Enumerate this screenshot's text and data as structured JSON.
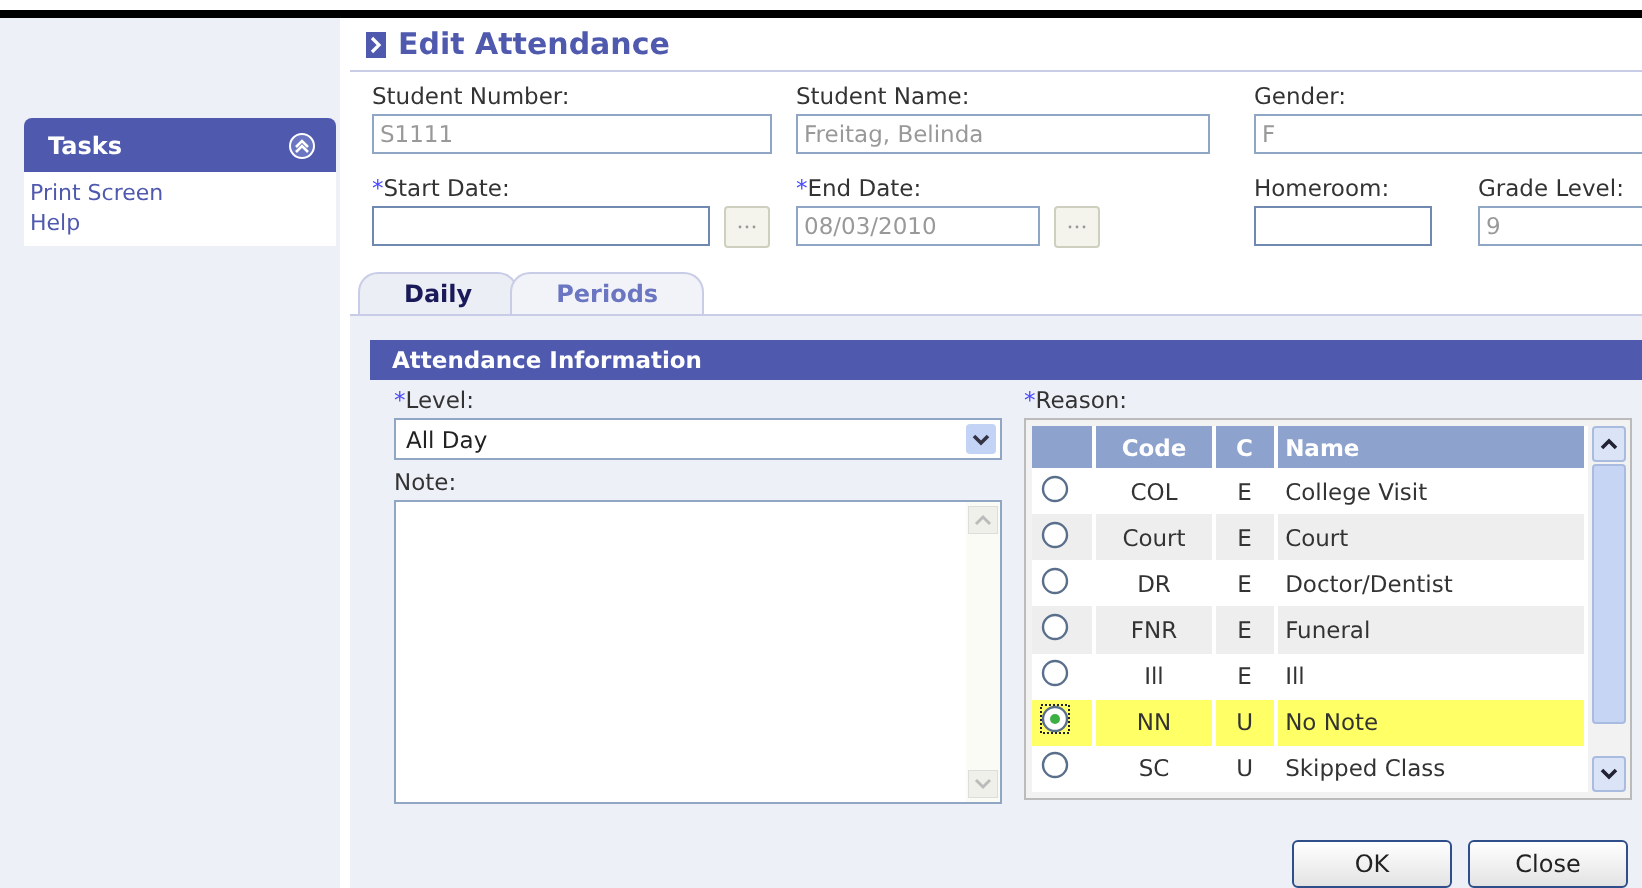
{
  "sidebar": {
    "title": "Tasks",
    "expanded": true,
    "links": [
      "Print Screen",
      "Help"
    ]
  },
  "page_title": "Edit Attendance",
  "fields": [
    {
      "label": "Student Number:",
      "required": false,
      "value": "S1111",
      "disabled": true,
      "kind": "text"
    },
    {
      "label": "Student Name:",
      "required": false,
      "value": "Freitag, Belinda",
      "disabled": true,
      "kind": "text"
    },
    {
      "label": "Gender:",
      "required": false,
      "value": "F",
      "disabled": true,
      "kind": "text"
    },
    {
      "label": "*Start Date:",
      "required": true,
      "disabled": false,
      "kind": "date"
    },
    {
      "label": "*End Date:",
      "required": true,
      "value": "08/03/2010",
      "disabled": true,
      "kind": "date"
    },
    {
      "label": "Homeroom:",
      "required": false,
      "disabled": false,
      "kind": "text"
    },
    {
      "label": "Grade Level:",
      "required": false,
      "value": "9",
      "disabled": true,
      "kind": "text"
    }
  ],
  "tabs": [
    {
      "label": "Daily",
      "selected": true
    },
    {
      "label": "Periods",
      "selected": false
    }
  ],
  "section_title": "Attendance Information",
  "level": {
    "label": "*Level:",
    "required": true,
    "value": "All Day"
  },
  "note": {
    "label": "Note:"
  },
  "reason": {
    "label": "*Reason:",
    "required": true,
    "columns": [
      "Code",
      "C",
      "Name"
    ],
    "rows": [
      {
        "code": "COL",
        "c": "E",
        "name": "College Visit",
        "selected": false
      },
      {
        "code": "Court",
        "c": "E",
        "name": "Court",
        "selected": false
      },
      {
        "code": "DR",
        "c": "E",
        "name": "Doctor/Dentist",
        "selected": false
      },
      {
        "code": "FNR",
        "c": "E",
        "name": "Funeral",
        "selected": false
      },
      {
        "code": "Ill",
        "c": "E",
        "name": "Ill",
        "selected": false
      },
      {
        "code": "NN",
        "c": "U",
        "name": "No Note",
        "selected": true
      },
      {
        "code": "SC",
        "c": "U",
        "name": "Skipped Class",
        "selected": false
      }
    ]
  },
  "buttons": [
    "OK",
    "Close"
  ]
}
